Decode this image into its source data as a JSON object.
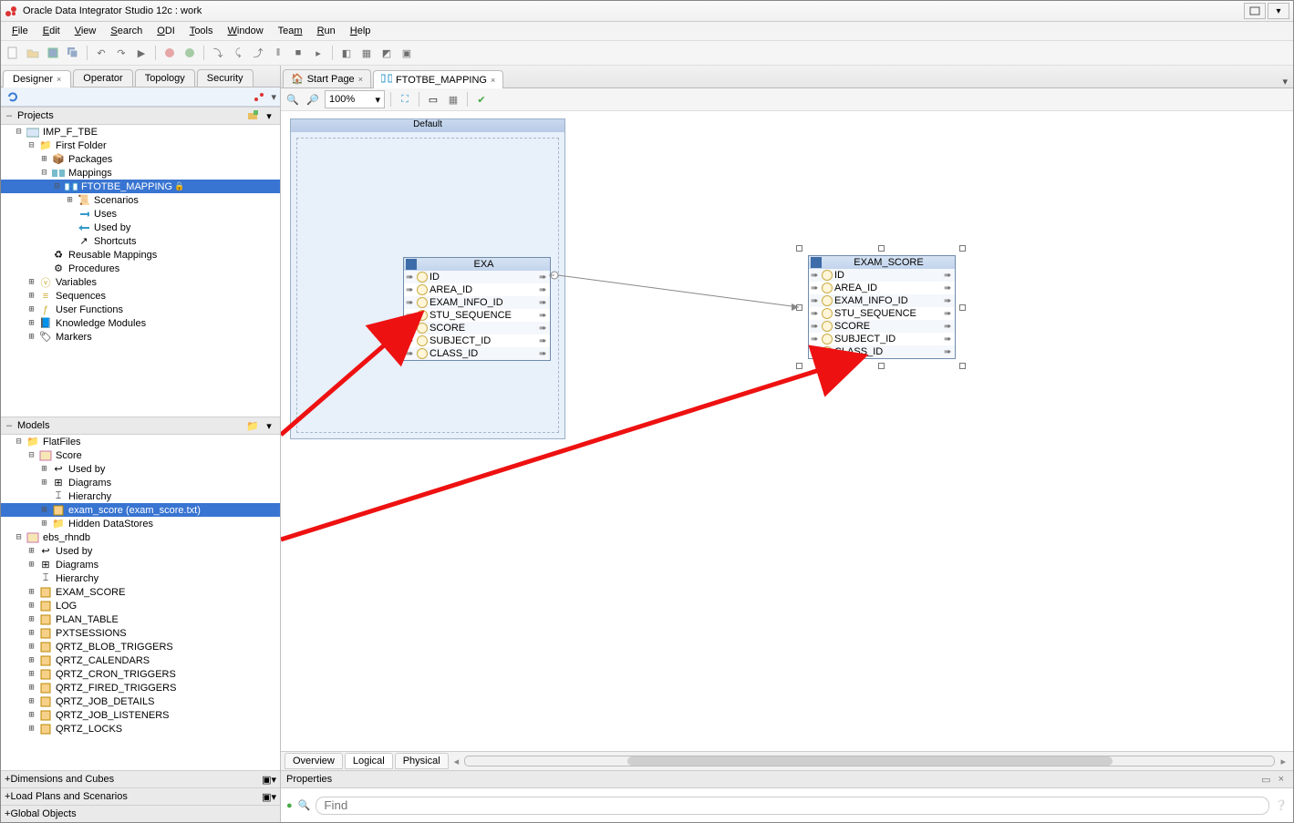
{
  "window": {
    "title": "Oracle Data Integrator Studio 12c : work"
  },
  "menu": {
    "file": "File",
    "edit": "Edit",
    "view": "View",
    "search": "Search",
    "odi": "ODI",
    "tools": "Tools",
    "window": "Window",
    "team": "Team",
    "run": "Run",
    "help": "Help"
  },
  "nav_tabs": {
    "designer": "Designer",
    "operator": "Operator",
    "topology": "Topology",
    "security": "Security"
  },
  "projects_panel": {
    "title": "Projects"
  },
  "projects_tree": {
    "root": "IMP_F_TBE",
    "first_folder": "First Folder",
    "packages": "Packages",
    "mappings": "Mappings",
    "ftotbe": "FTOTBE_MAPPING",
    "scenarios": "Scenarios",
    "uses": "Uses",
    "used_by": "Used by",
    "shortcuts": "Shortcuts",
    "reusable": "Reusable Mappings",
    "procedures": "Procedures",
    "variables": "Variables",
    "sequences": "Sequences",
    "user_functions": "User Functions",
    "km": "Knowledge Modules",
    "markers": "Markers"
  },
  "models_panel": {
    "title": "Models"
  },
  "models_tree": {
    "flatfiles": "FlatFiles",
    "score": "Score",
    "used_by": "Used by",
    "diagrams": "Diagrams",
    "hierarchy": "Hierarchy",
    "exam_score_file": "exam_score (exam_score.txt)",
    "hidden_ds": "Hidden DataStores",
    "ebs": "ebs_rhndb",
    "used_by2": "Used by",
    "diagrams2": "Diagrams",
    "hierarchy2": "Hierarchy",
    "exam_score": "EXAM_SCORE",
    "log": "LOG",
    "plan_table": "PLAN_TABLE",
    "pxtsessions": "PXTSESSIONS",
    "q_blob": "QRTZ_BLOB_TRIGGERS",
    "q_cal": "QRTZ_CALENDARS",
    "q_cron": "QRTZ_CRON_TRIGGERS",
    "q_fired": "QRTZ_FIRED_TRIGGERS",
    "q_job_d": "QRTZ_JOB_DETAILS",
    "q_job_l": "QRTZ_JOB_LISTENERS",
    "q_locks": "QRTZ_LOCKS"
  },
  "collapsed": {
    "dim": "Dimensions and Cubes",
    "load": "Load Plans and Scenarios",
    "global": "Global Objects"
  },
  "editor_tabs": {
    "start": "Start Page",
    "map": "FTOTBE_MAPPING"
  },
  "editor_toolbar": {
    "zoom": "100%"
  },
  "canvas": {
    "default_label": "Default",
    "exa": {
      "title": "EXA",
      "cols": [
        "ID",
        "AREA_ID",
        "EXAM_INFO_ID",
        "STU_SEQUENCE",
        "SCORE",
        "SUBJECT_ID",
        "CLASS_ID"
      ]
    },
    "exam_score": {
      "title": "EXAM_SCORE",
      "cols": [
        "ID",
        "AREA_ID",
        "EXAM_INFO_ID",
        "STU_SEQUENCE",
        "SCORE",
        "SUBJECT_ID",
        "CLASS_ID"
      ]
    }
  },
  "bottom_tabs": {
    "overview": "Overview",
    "logical": "Logical",
    "physical": "Physical"
  },
  "properties": {
    "title": "Properties",
    "find_placeholder": "Find"
  }
}
